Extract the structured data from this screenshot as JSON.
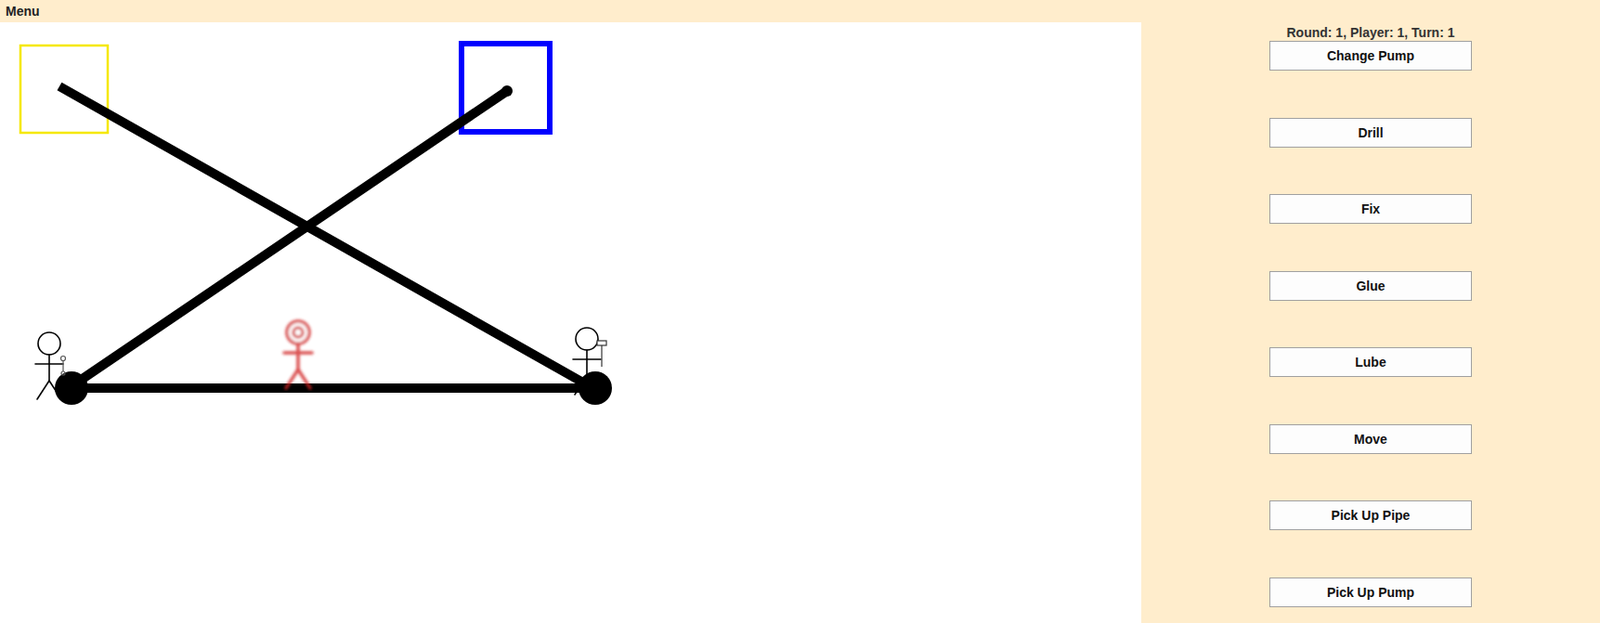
{
  "menu": {
    "label": "Menu"
  },
  "status": "Round: 1, Player: 1, Turn: 1",
  "buttons": [
    "Change Pump",
    "Drill",
    "Fix",
    "Glue",
    "Lube",
    "Move",
    "Pick Up Pipe",
    "Pick Up Pump"
  ],
  "board": {
    "fields": [
      {
        "kind": "area",
        "color": "#f5e800"
      },
      {
        "kind": "area",
        "color": "#0000ff"
      },
      {
        "kind": "pipe"
      },
      {
        "kind": "pipe"
      },
      {
        "kind": "pipe"
      },
      {
        "kind": "pump"
      },
      {
        "kind": "pump"
      }
    ],
    "players": [
      {
        "selected": false
      },
      {
        "selected": true
      },
      {
        "selected": false
      }
    ]
  }
}
